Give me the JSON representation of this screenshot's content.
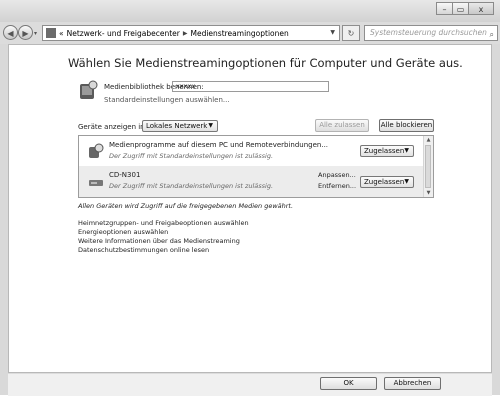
{
  "window": {
    "faded_title": "",
    "minimize_glyph": "–",
    "maximize_glyph": "▭",
    "close_glyph": "x"
  },
  "toolbar": {
    "back_glyph": "◀",
    "forward_glyph": "▶",
    "address": {
      "prefix": "«",
      "crumbs": [
        "Netzwerk- und Freigabecenter",
        "Medienstreamingoptionen"
      ],
      "separator": "▶"
    },
    "refresh_glyph": "↻",
    "search_placeholder": "Systemsteuerung durchsuchen",
    "search_icon": "search-icon"
  },
  "main": {
    "heading": "Wählen Sie Medienstreamingoptionen für Computer und Geräte aus.",
    "library_label": "Medienbibliothek benennen:",
    "library_value": "xxxxx",
    "standard_link": "Standardeinstellungen auswählen...",
    "devices_label": "Geräte anzeigen in:",
    "devices_select": "Lokales Netzwerk",
    "allow_all": "Alle zulassen",
    "block_all": "Alle blockieren",
    "devices": [
      {
        "title": "Medienprogramme auf diesem PC und Remoteverbindungen...",
        "subtitle": "Der Zugriff mit Standardeinstellungen ist zulässig.",
        "action1": "",
        "action2": "",
        "status": "Zugelassen",
        "icon": "media-player-icon"
      },
      {
        "title": "CD-N301",
        "subtitle": "Der Zugriff mit Standardeinstellungen ist zulässig.",
        "action1": "Anpassen...",
        "action2": "Entfernen...",
        "status": "Zugelassen",
        "icon": "network-device-icon"
      }
    ],
    "note": "Allen Geräten wird Zugriff auf die freigegebenen Medien gewährt.",
    "links": [
      "Heimnetzgruppen- und Freigabeoptionen auswählen",
      "Energieoptionen auswählen",
      "Weitere Informationen über das Medienstreaming",
      "Datenschutzbestimmungen online lesen"
    ]
  },
  "footer": {
    "ok": "OK",
    "cancel": "Abbrechen"
  }
}
